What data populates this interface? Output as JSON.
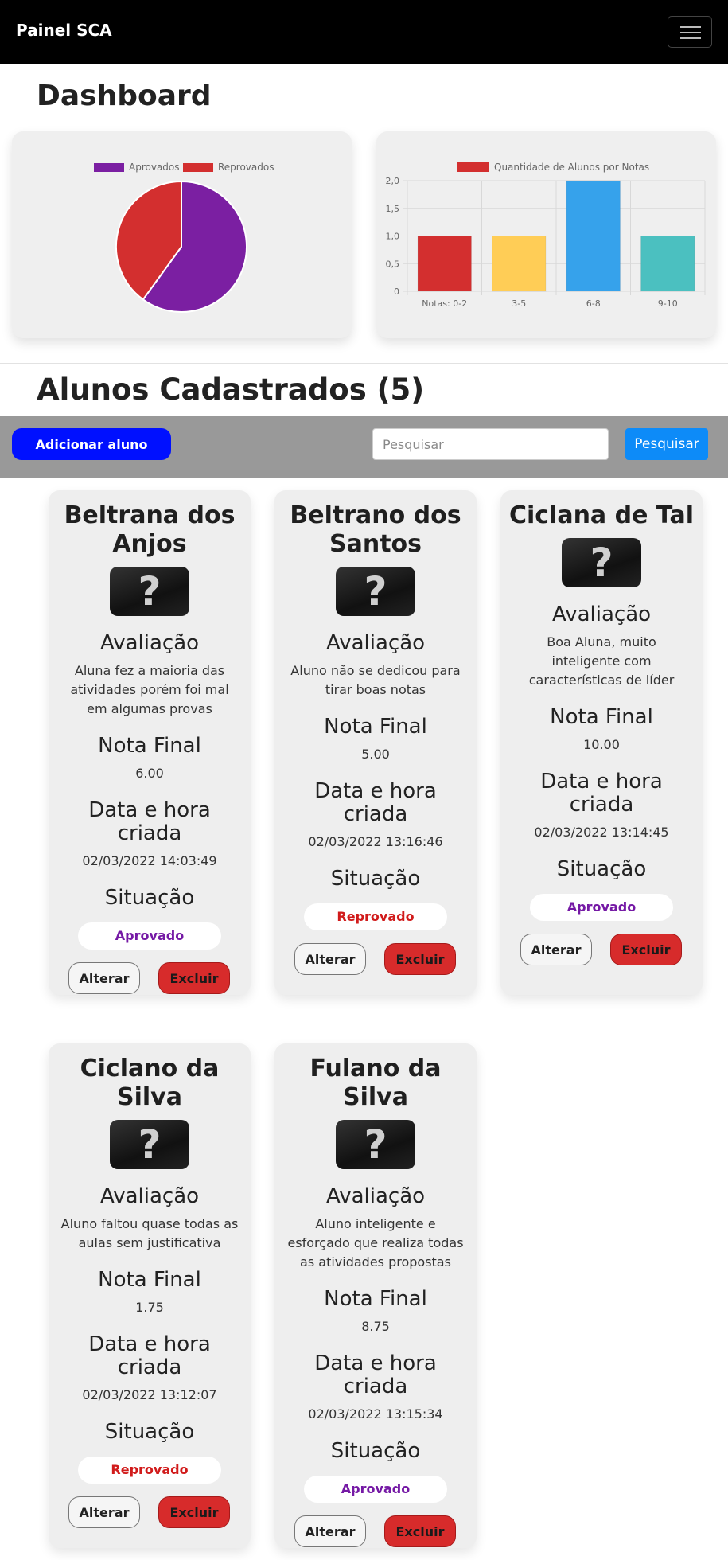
{
  "navbar": {
    "brand": "Painel SCA",
    "menu_icon": "hamburger-icon"
  },
  "dashboard": {
    "title": "Dashboard"
  },
  "colors": {
    "approved": "#7b1fa2",
    "failed": "#d32f2f",
    "yellow": "#ffcd56",
    "blue": "#36a2eb",
    "teal": "#4bc0c0",
    "add_button": "#0010ff",
    "search_button": "#0d8bf8"
  },
  "chart_data": [
    {
      "type": "pie",
      "legend": [
        "Aprovados",
        "Reprovados"
      ],
      "values": [
        3,
        2
      ],
      "colors": [
        "#7b1fa2",
        "#d32f2f"
      ],
      "legend_position": "top"
    },
    {
      "type": "bar",
      "legend": [
        "Quantidade de Alunos por Notas"
      ],
      "categories": [
        "Notas: 0-2",
        "3-5",
        "6-8",
        "9-10"
      ],
      "values": [
        1,
        1,
        2,
        1
      ],
      "colors": [
        "#d32f2f",
        "#ffcd56",
        "#36a2eb",
        "#4bc0c0"
      ],
      "ylim": [
        0,
        2
      ],
      "yticks": [
        "2,0",
        "1,5",
        "1,0",
        "0,5",
        "0"
      ],
      "grid": true,
      "legend_position": "top"
    }
  ],
  "students_section": {
    "title": "Alunos Cadastrados (5)"
  },
  "toolbar": {
    "add_label": "Adicionar aluno",
    "search_placeholder": "Pesquisar",
    "search_label": "Pesquisar"
  },
  "labels": {
    "evaluation": "Avaliação",
    "final_grade": "Nota Final",
    "created": "Data e hora criada",
    "status": "Situação",
    "edit": "Alterar",
    "delete": "Excluir"
  },
  "students": [
    {
      "name": "Beltrana dos Anjos",
      "evaluation": "Aluna fez a maioria das atividades porém foi mal em algumas provas",
      "grade": "6.00",
      "created": "02/03/2022 14:03:49",
      "status": "Aprovado"
    },
    {
      "name": "Beltrano dos Santos",
      "evaluation": "Aluno não se dedicou para tirar boas notas",
      "grade": "5.00",
      "created": "02/03/2022 13:16:46",
      "status": "Reprovado"
    },
    {
      "name": "Ciclana de Tal",
      "evaluation": "Boa Aluna, muito inteligente com características de líder",
      "grade": "10.00",
      "created": "02/03/2022 13:14:45",
      "status": "Aprovado"
    },
    {
      "name": "Ciclano da Silva",
      "evaluation": "Aluno faltou quase todas as aulas sem justificativa",
      "grade": "1.75",
      "created": "02/03/2022 13:12:07",
      "status": "Reprovado"
    },
    {
      "name": "Fulano da Silva",
      "evaluation": "Aluno inteligente e esforçado que realiza todas as atividades propostas",
      "grade": "8.75",
      "created": "02/03/2022 13:15:34",
      "status": "Aprovado"
    }
  ]
}
